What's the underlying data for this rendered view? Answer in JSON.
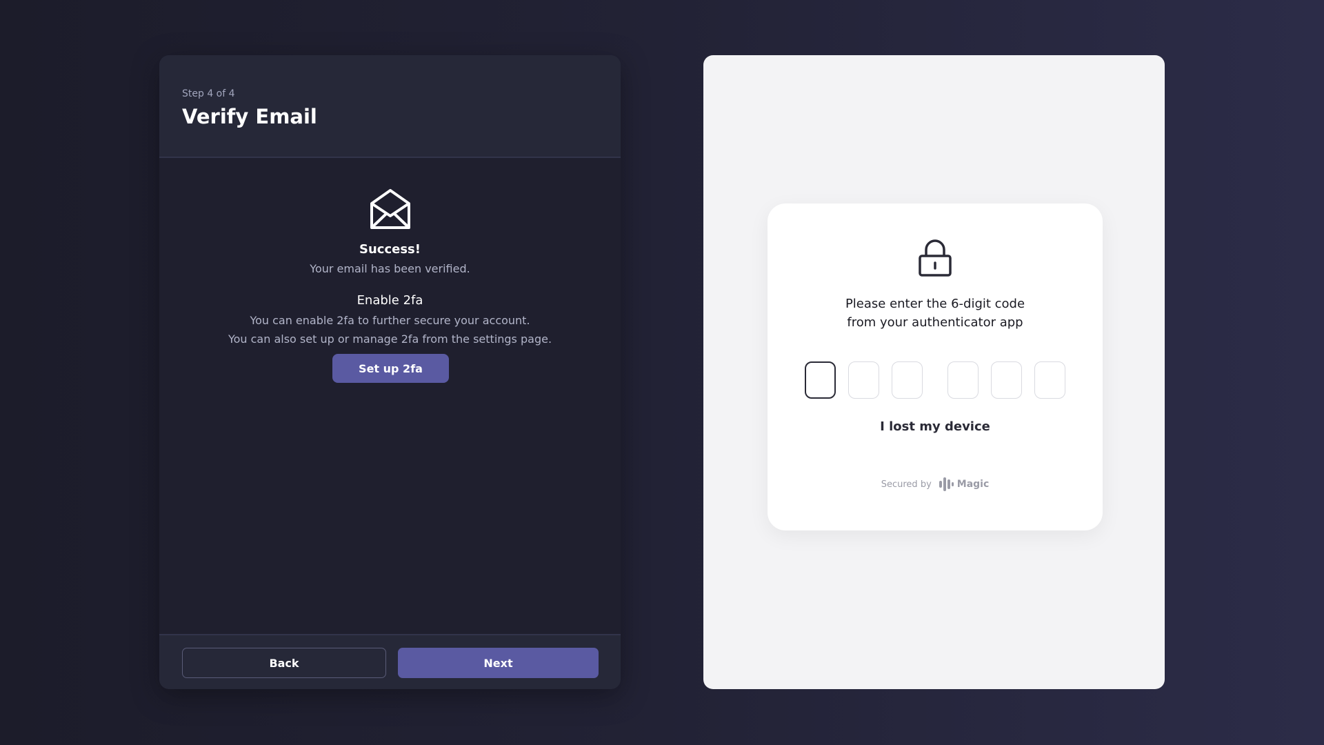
{
  "left_panel": {
    "step_label": "Step 4 of 4",
    "title": "Verify Email",
    "mail_icon": "envelope-open-icon",
    "success_title": "Success!",
    "success_text": "Your email has been verified.",
    "twofa_title": "Enable 2fa",
    "twofa_text_1": "You can enable 2fa to further secure your account.",
    "twofa_text_2": "You can also set up or manage 2fa from the settings page.",
    "setup_button": "Set up 2fa",
    "back_button": "Back",
    "next_button": "Next"
  },
  "auth_card": {
    "lock_icon": "lock-icon",
    "prompt_line_1": "Please enter the 6-digit code",
    "prompt_line_2": "from your authenticator app",
    "code_digits": [
      "",
      "",
      "",
      "",
      "",
      ""
    ],
    "lost_device_link": "I lost my device",
    "secured_by": "Secured by",
    "brand": "Magic"
  },
  "colors": {
    "accent": "#5a5aa2",
    "dark_panel": "#1f1f2e",
    "light_panel": "#f3f3f5"
  }
}
